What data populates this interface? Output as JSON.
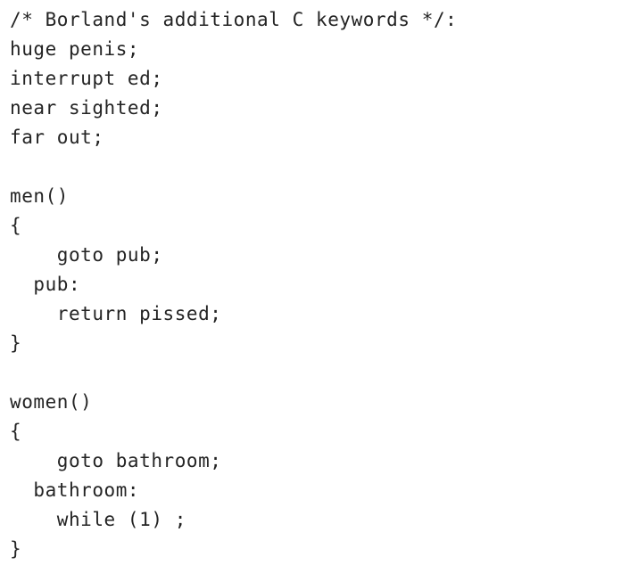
{
  "document": {
    "kind": "code-listing",
    "language": "C",
    "title": "Borland's additional C keywords",
    "background_color": "#ffffff",
    "text_color": "#242424",
    "line_count": 19
  },
  "code": {
    "lines": [
      "/* Borland's additional C keywords */:",
      "huge penis;",
      "interrupt ed;",
      "near sighted;",
      "far out;",
      "",
      "men()",
      "{",
      "    goto pub;",
      "  pub:",
      "    return pissed;",
      "}",
      "",
      "women()",
      "{",
      "    goto bathroom;",
      "  bathroom:",
      "    while (1) ;",
      "}"
    ]
  }
}
